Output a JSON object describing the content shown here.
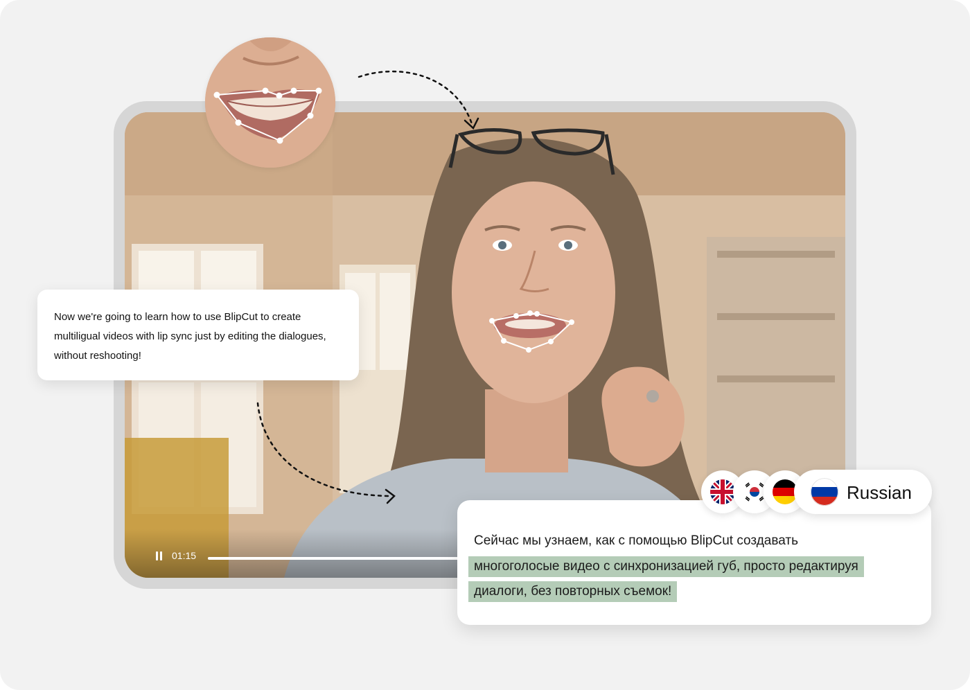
{
  "captions": {
    "source_text": "Now we're going to learn how to use BlipCut to create multiligual videos with lip sync just by editing the dialogues, without reshooting!",
    "translated_lines": [
      "Сейчас мы узнаем, как с помощью BlipCut создавать",
      "многоголосые видео с синхронизацией губ, просто редактируя",
      "диалоги, без повторных съемок!"
    ]
  },
  "player": {
    "time": "01:15",
    "progress_fraction": 0.45
  },
  "languages": {
    "flags": [
      "uk-flag-icon",
      "south-korea-flag-icon",
      "germany-flag-icon"
    ],
    "selected": {
      "flag": "russia-flag-icon",
      "label": "Russian"
    }
  },
  "colors": {
    "highlight": "#b4ccb7",
    "background": "#f2f2f2",
    "frame": "#d6d6d6",
    "landmark": "#ffffff"
  }
}
